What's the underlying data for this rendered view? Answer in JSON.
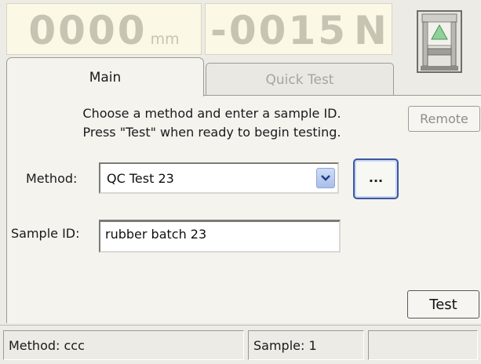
{
  "readouts": {
    "position": {
      "value": "0000",
      "unit": "mm"
    },
    "force": {
      "value": "-0015",
      "unit": "N"
    }
  },
  "frame_icon": "load-frame-icon",
  "tabs": [
    {
      "label": "Main",
      "active": true
    },
    {
      "label": "Quick Test",
      "active": false
    }
  ],
  "instructions": {
    "line1": "Choose a method and enter a sample ID.",
    "line2": "Press \"Test\" when ready to begin testing."
  },
  "remote_label": "Remote",
  "method": {
    "label": "Method:",
    "value": "QC Test 23",
    "browse_label": "..."
  },
  "sample": {
    "label": "Sample ID:",
    "value": "rubber batch 23"
  },
  "test_label": "Test",
  "status": {
    "method": "Method: ccc",
    "sample": "Sample: 1",
    "extra": ""
  },
  "colors": {
    "background": "#ecebe5",
    "panel": "#f4f3ee",
    "readout_bg": "#fbf8e6",
    "readout_text": "#c7c4b4",
    "accent_blue": "#3a57a0",
    "indicator_green": "#8fd19a"
  }
}
